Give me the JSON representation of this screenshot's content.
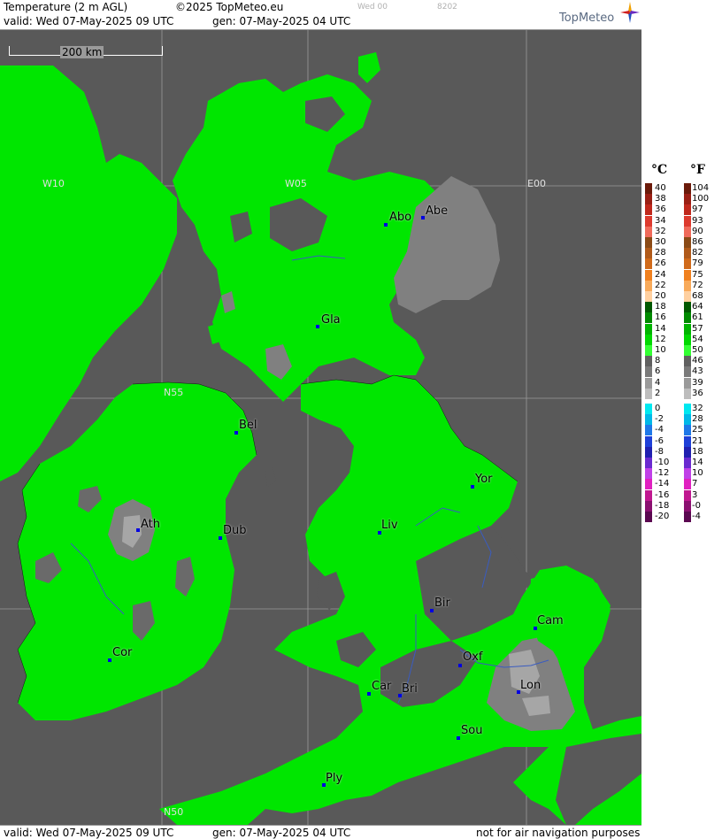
{
  "header": {
    "product": "Temperature (2 m AGL)",
    "copyright": "©2025 TopMeteo.eu",
    "step": "Wed 00",
    "code": "8202",
    "valid": "valid:  Wed  07-May-2025  09 UTC",
    "generated": "gen: 07-May-2025 04 UTC",
    "brand": "TopMeteo"
  },
  "footer": {
    "valid": "valid:  Wed  07-May-2025  09 UTC",
    "generated": "gen: 07-May-2025 04 UTC",
    "disclaimer": "not for air navigation purposes"
  },
  "map": {
    "scale_label": "200 km",
    "grid_labels": [
      "W10",
      "W05",
      "E00",
      "N55",
      "N50"
    ],
    "colors": {
      "sea": "#595959",
      "land_green": "#00e600",
      "land_green_light": "#33ff33",
      "land_grey": "#808080",
      "land_grey_light": "#a6a6a6",
      "city_marker": "#0000e0"
    },
    "cities": [
      {
        "label": "Abo"
      },
      {
        "label": "Abe"
      },
      {
        "label": "Gla"
      },
      {
        "label": "Bel"
      },
      {
        "label": "Ath"
      },
      {
        "label": "Dub"
      },
      {
        "label": "Yor"
      },
      {
        "label": "Liv"
      },
      {
        "label": "Bir"
      },
      {
        "label": "Cam"
      },
      {
        "label": "Oxf"
      },
      {
        "label": "Car"
      },
      {
        "label": "Bri"
      },
      {
        "label": "Lon"
      },
      {
        "label": "Sou"
      },
      {
        "label": "Cor"
      },
      {
        "label": "Ply"
      }
    ]
  },
  "legend": {
    "unit_c": "°C",
    "unit_f": "°F",
    "rows": [
      {
        "c": "40",
        "f": "104",
        "color": "#6b1a0a"
      },
      {
        "c": "38",
        "f": "100",
        "color": "#9a1f14"
      },
      {
        "c": "36",
        "f": "97",
        "color": "#c0281c"
      },
      {
        "c": "34",
        "f": "93",
        "color": "#dd3a2e"
      },
      {
        "c": "32",
        "f": "90",
        "color": "#f06a5a"
      },
      {
        "c": "30",
        "f": "86",
        "color": "#8a4a16"
      },
      {
        "c": "28",
        "f": "82",
        "color": "#b05a1a"
      },
      {
        "c": "26",
        "f": "79",
        "color": "#d06a1a"
      },
      {
        "c": "24",
        "f": "75",
        "color": "#f0801e"
      },
      {
        "c": "22",
        "f": "72",
        "color": "#f8aa5a"
      },
      {
        "c": "20",
        "f": "68",
        "color": "#ffd0a0"
      },
      {
        "c": "18",
        "f": "64",
        "color": "#005800"
      },
      {
        "c": "16",
        "f": "61",
        "color": "#008a00"
      },
      {
        "c": "14",
        "f": "57",
        "color": "#00b400"
      },
      {
        "c": "12",
        "f": "54",
        "color": "#00d800"
      },
      {
        "c": "10",
        "f": "50",
        "color": "#33ff33"
      },
      {
        "c": "8",
        "f": "46",
        "color": "#606060"
      },
      {
        "c": "6",
        "f": "43",
        "color": "#7a7a7a"
      },
      {
        "c": "4",
        "f": "39",
        "color": "#9a9a9a"
      },
      {
        "c": "2",
        "f": "36",
        "color": "#bdbdbd"
      },
      {
        "c": "0",
        "f": "32",
        "color": "#00e8f0"
      },
      {
        "c": "-2",
        "f": "28",
        "color": "#00b8e8"
      },
      {
        "c": "-4",
        "f": "25",
        "color": "#1e78e8"
      },
      {
        "c": "-6",
        "f": "21",
        "color": "#1e40d8"
      },
      {
        "c": "-8",
        "f": "18",
        "color": "#2020b0"
      },
      {
        "c": "-10",
        "f": "14",
        "color": "#6a2ad0"
      },
      {
        "c": "-12",
        "f": "10",
        "color": "#c040e8"
      },
      {
        "c": "-14",
        "f": "7",
        "color": "#e020c0"
      },
      {
        "c": "-16",
        "f": "3",
        "color": "#c01890"
      },
      {
        "c": "-18",
        "f": "-0",
        "color": "#8a1070"
      },
      {
        "c": "-20",
        "f": "-4",
        "color": "#5a0850"
      }
    ]
  }
}
